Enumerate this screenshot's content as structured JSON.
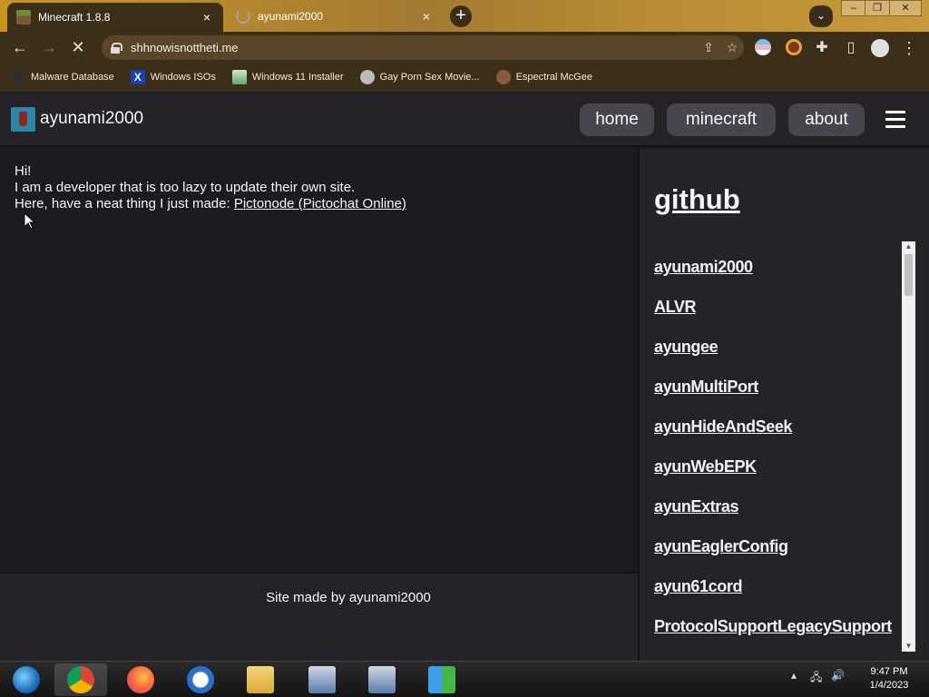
{
  "browser": {
    "tabs": [
      {
        "title": "Minecraft 1.8.8",
        "active": true
      },
      {
        "title": "ayunami2000",
        "active": false
      }
    ],
    "new_tab_symbol": "+",
    "tab_close_symbol": "×",
    "url": "shhnowisnottheti.me",
    "bookmarks": [
      {
        "label": "Malware Database",
        "icon": "bug-icon"
      },
      {
        "label": "Windows ISOs",
        "icon": "x-logo-icon"
      },
      {
        "label": "Windows 11 Installer",
        "icon": "image-icon"
      },
      {
        "label": "Gay Porn Sex Movie...",
        "icon": "site-icon"
      },
      {
        "label": "Espectral McGee",
        "icon": "avatar-icon"
      }
    ]
  },
  "site": {
    "name": "ayunami2000",
    "nav": [
      {
        "label": "home"
      },
      {
        "label": "minecraft"
      },
      {
        "label": "about"
      }
    ],
    "intro": {
      "line1": "Hi!",
      "line2": "I am a developer that is too lazy to update their own site.",
      "line3_prefix": "Here, have a neat thing I just made: ",
      "link": "Pictonode (Pictochat Online)"
    },
    "footer": "Site made by ayunami2000",
    "sidebar": {
      "title": "github",
      "repos": [
        "ayunami2000",
        "ALVR",
        "ayungee",
        "ayunMultiPort",
        "ayunHideAndSeek",
        "ayunWebEPK",
        "ayunExtras",
        "ayunEaglerConfig",
        "ayun61cord",
        "ProtocolSupportLegacySupport"
      ]
    }
  },
  "taskbar": {
    "apps": [
      "windows-start",
      "chrome",
      "firefox",
      "opera",
      "file-explorer",
      "network-installer",
      "network-installer",
      "windows-live-messenger"
    ],
    "time": "9:47 PM",
    "date": "1/4/2023"
  }
}
